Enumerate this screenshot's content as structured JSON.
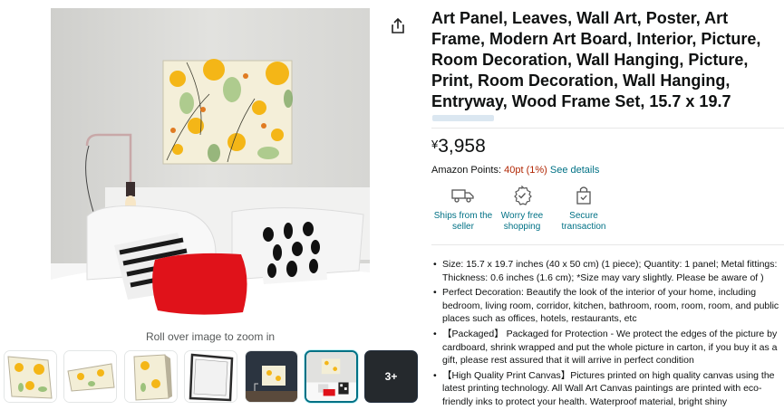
{
  "gallery": {
    "zoom_hint": "Roll over image to zoom in",
    "more_label": "3+",
    "selected_index": 5
  },
  "product": {
    "title": "Art Panel, Leaves, Wall Art, Poster, Art Frame, Modern Art Board, Interior, Picture, Room Decoration, Wall Hanging, Picture, Print, Room Decoration, Wall Hanging, Entryway, Wood Frame Set, 15.7 x 19.7",
    "price_currency": "¥",
    "price_amount": "3,958",
    "points_label": "Amazon Points:",
    "points_value": "40pt",
    "points_percent": "(1%)",
    "points_link": "See details"
  },
  "badges": [
    {
      "label": "Ships from the seller",
      "icon": "truck-icon"
    },
    {
      "label": "Worry free shopping",
      "icon": "shield-check-icon"
    },
    {
      "label": "Secure transaction",
      "icon": "lock-bag-icon"
    }
  ],
  "bullets": [
    "Size: 15.7 x 19.7 inches (40 x 50 cm) (1 piece); Quantity: 1 panel; Metal fittings: Thickness: 0.6 inches (1.6 cm); *Size may vary slightly. Please be aware of )",
    "Perfect Decoration: Beautify the look of the interior of your home, including bedroom, living room, corridor, kitchen, bathroom, room, room, room, and public places such as offices, hotels, restaurants, etc",
    "【Packaged】 Packaged for Protection - We protect the edges of the picture by cardboard, shrink wrapped and put the whole picture in carton, if you buy it as a gift, please rest assured that it will arrive in perfect condition",
    "【High Quality Print Canvas】Pictures printed on high quality canvas using the latest printing technology. All Wall Art Canvas paintings are printed with eco-friendly inks to protect your health. Waterproof material, bright shiny"
  ],
  "colors": {
    "link": "#007185",
    "price_red": "#b12704",
    "text": "#0f1111",
    "selected_border": "#007185"
  }
}
